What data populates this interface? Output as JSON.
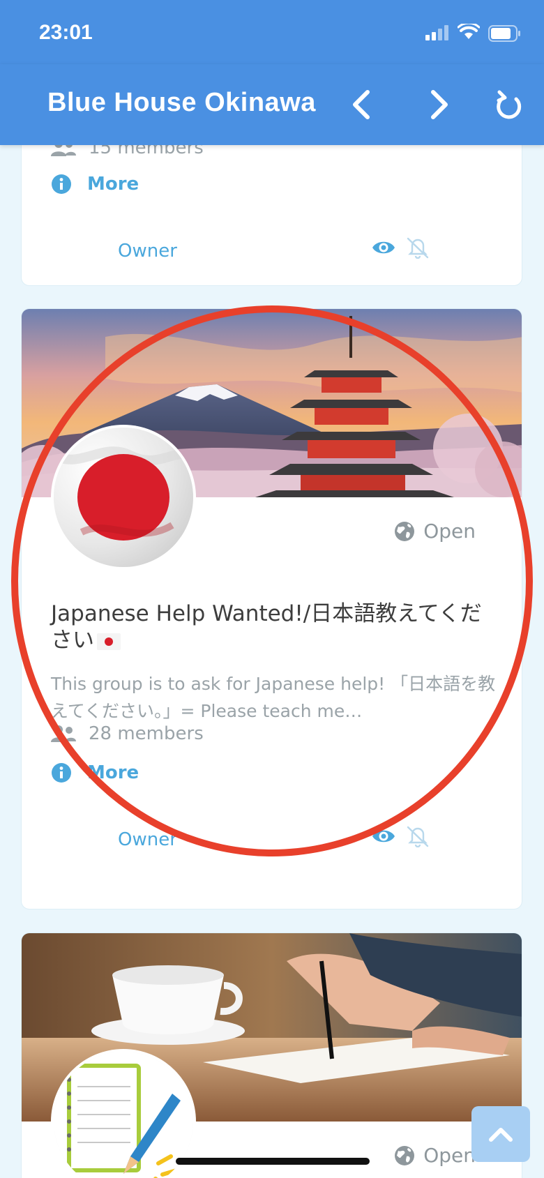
{
  "status": {
    "time": "23:01"
  },
  "nav": {
    "title": "Blue House Okinawa"
  },
  "cards": [
    {
      "members": "15 members",
      "more": "More",
      "role": "Owner"
    },
    {
      "visibility": "Open",
      "title": "Japanese Help Wanted!/日本語教えてください",
      "description": "This group is to ask for Japanese help! 「日本語を教えてください。」= Please teach me…",
      "members": "28 members",
      "more": "More",
      "role": "Owner"
    },
    {
      "visibility": "Open"
    }
  ],
  "colors": {
    "primary": "#4a90e2",
    "accent": "#4aa7dc",
    "highlight": "#e8402b",
    "flag_red": "#d81e2a"
  },
  "icons": [
    "back-icon",
    "forward-icon",
    "refresh-icon",
    "users-icon",
    "info-icon",
    "eye-icon",
    "bell-off-icon",
    "globe-icon",
    "chevron-up-icon"
  ]
}
